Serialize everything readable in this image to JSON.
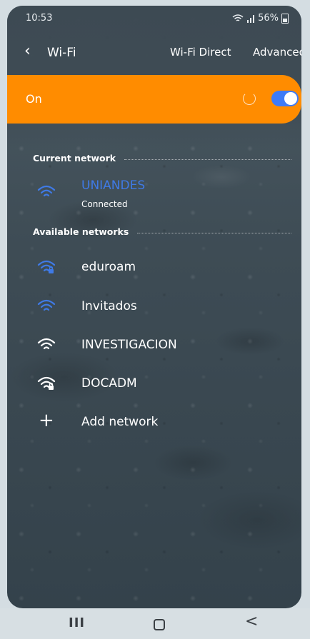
{
  "status": {
    "time": "10:53",
    "battery": "56%",
    "icons": [
      "wifi-status-icon",
      "signal-icon",
      "battery-icon"
    ]
  },
  "header": {
    "back_icon": "chevron-left-icon",
    "title": "Wi-Fi",
    "wifi_direct": "Wi-Fi Direct",
    "advanced": "Advanced"
  },
  "toggle_bar": {
    "label": "On",
    "checked": true,
    "color": "#ff8c00",
    "toggle_color": "#3e7bf7"
  },
  "current_section": {
    "title": "Current network"
  },
  "current_network": {
    "name": "UNIANDES",
    "status": "Connected",
    "icon": "wifi-icon",
    "color": "#3f7ae6"
  },
  "available_section": {
    "title": "Available networks"
  },
  "available_networks": [
    {
      "name": "eduroam",
      "icon": "wifi-lock-icon",
      "color": "#3f7ae6"
    },
    {
      "name": "Invitados",
      "icon": "wifi-icon",
      "color": "#3f7ae6"
    },
    {
      "name": "INVESTIGACION",
      "icon": "wifi-icon",
      "color": "#ffffff"
    },
    {
      "name": "DOCADM",
      "icon": "wifi-lock-icon",
      "color": "#ffffff"
    }
  ],
  "add_network": {
    "label": "Add network",
    "icon": "plus-icon"
  },
  "nav": {
    "recent": "III",
    "home_icon": "home-icon",
    "back": "<"
  }
}
